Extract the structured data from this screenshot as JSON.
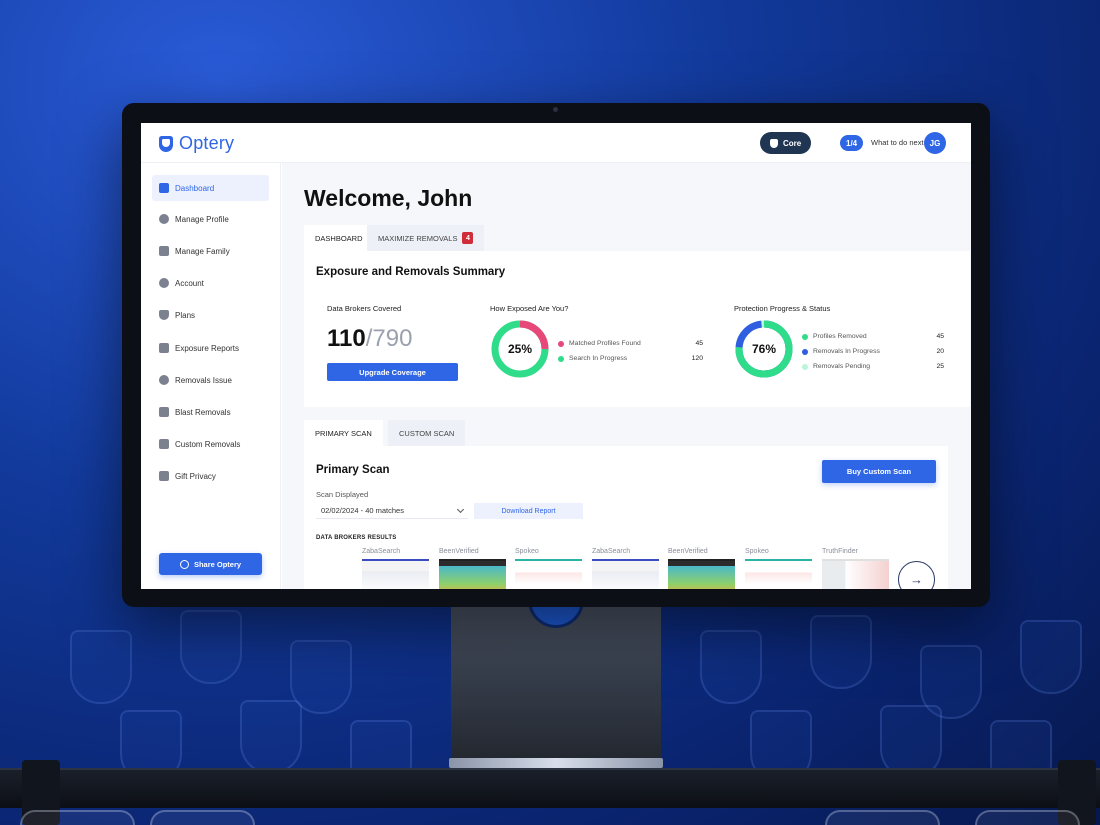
{
  "app": {
    "name": "Optery"
  },
  "topbar": {
    "plan_badge": "Core",
    "steps": "1/4",
    "next_label": "What to do next",
    "avatar_initials": "JG"
  },
  "sidebar": {
    "items": [
      {
        "label": "Dashboard",
        "icon": "dashboard-icon",
        "active": true
      },
      {
        "label": "Manage Profile",
        "icon": "gear-icon"
      },
      {
        "label": "Manage Family",
        "icon": "family-icon"
      },
      {
        "label": "Account",
        "icon": "user-circle-icon"
      },
      {
        "label": "Plans",
        "icon": "shield-icon"
      },
      {
        "label": "Exposure Reports",
        "icon": "report-icon"
      },
      {
        "label": "Removals Issue",
        "icon": "alert-icon"
      },
      {
        "label": "Blast Removals",
        "icon": "mail-blast-icon"
      },
      {
        "label": "Custom Removals",
        "icon": "user-plus-icon"
      },
      {
        "label": "Gift Privacy",
        "icon": "gift-icon"
      }
    ],
    "share_button": "Share Optery"
  },
  "main": {
    "welcome": "Welcome, John",
    "tabs": [
      {
        "label": "DASHBOARD",
        "active": true
      },
      {
        "label": "MAXIMIZE REMOVALS",
        "badge": "4"
      }
    ],
    "summary": {
      "title": "Exposure and Removals Summary",
      "brokers": {
        "label": "Data Brokers Covered",
        "covered": "110",
        "total": "/790",
        "upgrade_button": "Upgrade Coverage"
      },
      "exposure": {
        "label": "How Exposed Are You?",
        "percent_label": "25%",
        "percent": 25,
        "legend": [
          {
            "label": "Matched Profiles Found",
            "value": "45",
            "color": "#e8477a"
          },
          {
            "label": "Search In Progress",
            "value": "120",
            "color": "#2fdc8a"
          }
        ]
      },
      "protection": {
        "label": "Protection Progress & Status",
        "percent_label": "76%",
        "percent": 76,
        "legend": [
          {
            "label": "Profiles Removed",
            "value": "45",
            "color": "#2fdc8a"
          },
          {
            "label": "Removals In Progress",
            "value": "20",
            "color": "#2f5ee0"
          },
          {
            "label": "Removals Pending",
            "value": "25",
            "color": "#b9f5d8"
          }
        ]
      }
    },
    "scan_tabs": [
      {
        "label": "PRIMARY SCAN",
        "active": true
      },
      {
        "label": "CUSTOM SCAN"
      }
    ],
    "scan": {
      "title": "Primary Scan",
      "buy_button": "Buy Custom Scan",
      "displayed_label": "Scan Displayed",
      "selected_scan": "02/02/2024 - 40 matches",
      "download_button": "Download Report",
      "results_label": "DATA BROKERS RESULTS",
      "brokers": [
        "ZabaSearch",
        "BeenVerified",
        "Spokeo",
        "ZabaSearch",
        "BeenVerified",
        "Spokeo",
        "TruthFinder"
      ]
    }
  },
  "colors": {
    "accent": "#2f66e6",
    "badge_red": "#d12c3a",
    "green": "#2fdc8a",
    "pink": "#e8477a"
  }
}
